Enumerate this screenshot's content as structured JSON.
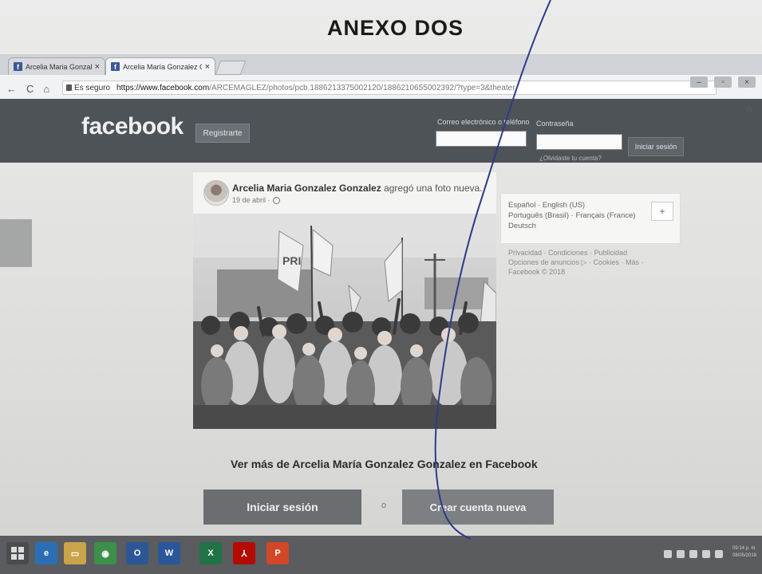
{
  "document": {
    "title": "ANEXO DOS"
  },
  "browser": {
    "tabs": [
      {
        "label": "Arcelia Maria Gonzalez G",
        "close": "×"
      },
      {
        "label": "Arcelia María Gonzalez C",
        "close": "×"
      }
    ],
    "nav": {
      "back": "←",
      "forward": "→",
      "reload": "C",
      "home": "⌂"
    },
    "address": {
      "secure_label": "Es seguro",
      "host": "https://www.facebook.com",
      "path": "/ARCEMAGLEZ/photos/pcb.1886213375002120/1886210655002392/?type=3&theater"
    },
    "star": "☆",
    "window_controls": [
      "–",
      "▫",
      "×"
    ]
  },
  "facebook": {
    "logo": "facebook",
    "register_button": "Registrarte",
    "email_label": "Correo electrónico o teléfono",
    "password_label": "Contraseña",
    "forgot_link": "¿Olvidaste tu cuenta?",
    "login_button": "Iniciar sesión"
  },
  "post": {
    "author": "Arcelia Maria Gonzalez Gonzalez",
    "action": " agregó una foto nueva.",
    "date": "19 de abril ·"
  },
  "sidebar": {
    "languages_line1": "Español · English (US)",
    "languages_line2": "Português (Brasil) · Français (France)",
    "languages_line3": "Deutsch",
    "plus": "+",
    "footer_line1": "Privacidad · Condiciones · Publicidad",
    "footer_line2": "Opciones de anuncios ▷ · Cookies · Más ·",
    "footer_line3": "Facebook © 2018"
  },
  "bottom": {
    "see_more": "Ver más de Arcelia María Gonzalez Gonzalez en Facebook",
    "login_button": "Iniciar sesión",
    "or": "o",
    "create_button": "Crear cuenta nueva"
  },
  "taskbar": {
    "apps": [
      {
        "name": "ie",
        "glyph": "e",
        "color": "#2a6fb5"
      },
      {
        "name": "explorer",
        "glyph": "▭",
        "color": "#c9a44a"
      },
      {
        "name": "chrome",
        "glyph": "◉",
        "color": "#3d8f4a"
      },
      {
        "name": "outlook",
        "glyph": "O",
        "color": "#2b5797"
      },
      {
        "name": "word",
        "glyph": "W",
        "color": "#2b579a"
      },
      {
        "name": "excel",
        "glyph": "X",
        "color": "#217346"
      },
      {
        "name": "acrobat",
        "glyph": "⅄",
        "color": "#b30b00"
      },
      {
        "name": "powerpoint",
        "glyph": "P",
        "color": "#d24726"
      }
    ],
    "clock_time": "09:14 p. m.",
    "clock_date": "08/05/2018"
  }
}
